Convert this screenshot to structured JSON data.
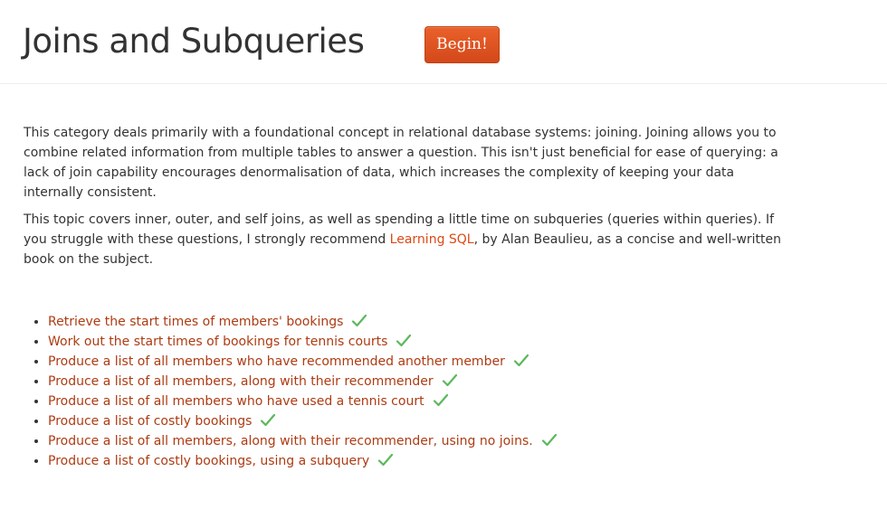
{
  "header": {
    "title": "Joins and Subqueries",
    "begin_label": "Begin!"
  },
  "intro": {
    "p1": "This category deals primarily with a foundational concept in relational database systems: joining. Joining allows you to combine related information from multiple tables to answer a question. This isn't just beneficial for ease of querying: a lack of join capability encourages denormalisation of data, which increases the complexity of keeping your data internally consistent.",
    "p2_before": "This topic covers inner, outer, and self joins, as well as spending a little time on subqueries (queries within queries). If you struggle with these questions, I strongly recommend ",
    "p2_link": "Learning SQL",
    "p2_after": ", by Alan Beaulieu, as a concise and well-written book on the subject."
  },
  "exercises": [
    {
      "label": "Retrieve the start times of members' bookings",
      "completed": true
    },
    {
      "label": "Work out the start times of bookings for tennis courts",
      "completed": true
    },
    {
      "label": "Produce a list of all members who have recommended another member",
      "completed": true
    },
    {
      "label": "Produce a list of all members, along with their recommender",
      "completed": true
    },
    {
      "label": "Produce a list of all members who have used a tennis court",
      "completed": true
    },
    {
      "label": "Produce a list of costly bookings",
      "completed": true
    },
    {
      "label": "Produce a list of all members, along with their recommender, using no joins.",
      "completed": true
    },
    {
      "label": "Produce a list of costly bookings, using a subquery",
      "completed": true
    }
  ],
  "colors": {
    "accent": "#dd4814",
    "link": "#ae3b12",
    "check": "#5cb85c"
  },
  "icons": {
    "completed": "check-icon"
  }
}
